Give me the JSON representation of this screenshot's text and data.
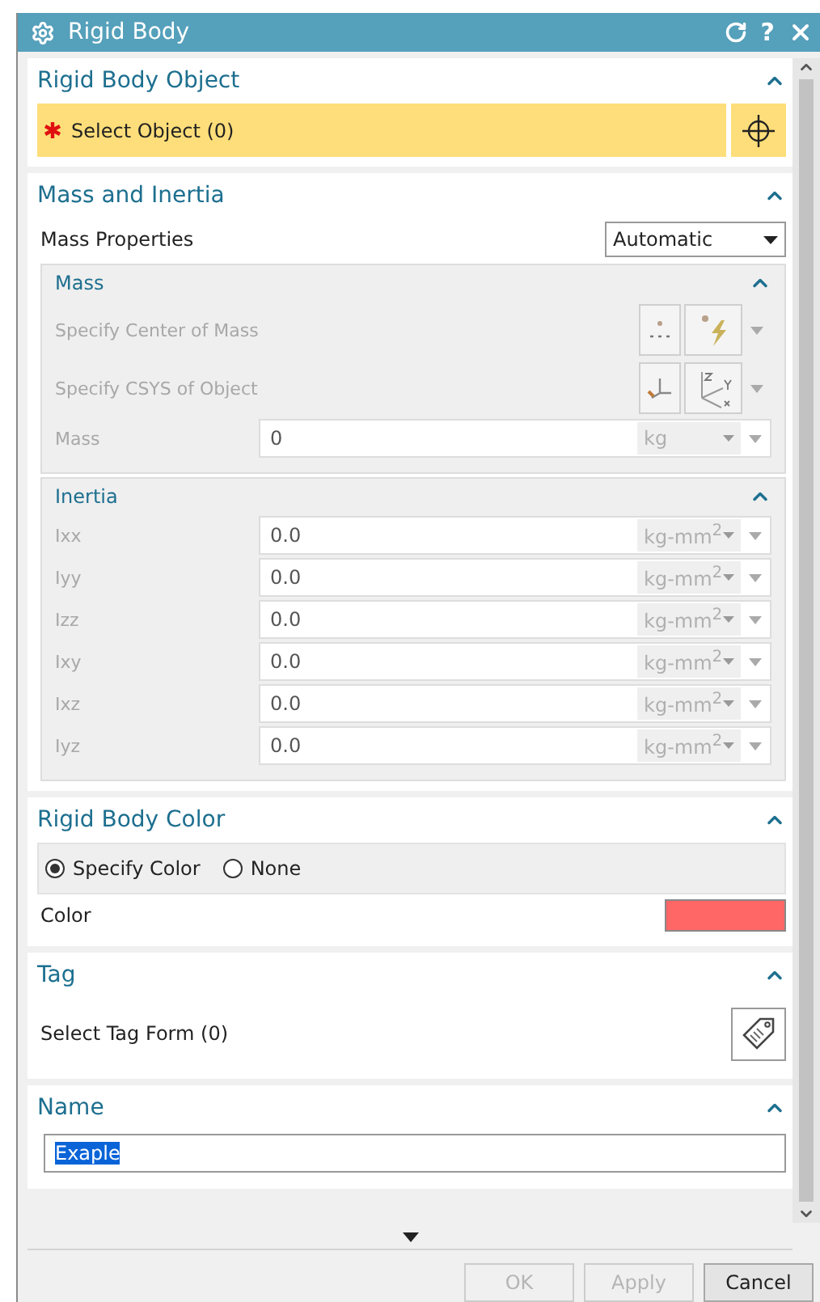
{
  "window": {
    "title": "Rigid Body",
    "help": "?"
  },
  "rigid_body_object": {
    "title": "Rigid Body Object",
    "expanded": true,
    "selection": {
      "label": "Select Object (0)",
      "required": true
    }
  },
  "mass_and_inertia": {
    "title": "Mass and Inertia",
    "expanded": true,
    "mass_properties": {
      "label": "Mass Properties",
      "value": "Automatic"
    },
    "mass": {
      "title": "Mass",
      "expanded": true,
      "disabled": true,
      "rows": [
        {
          "kind": "point",
          "label": "Specify Center of Mass"
        },
        {
          "kind": "csys",
          "label": "Specify CSYS of Object"
        },
        {
          "kind": "value",
          "label": "Mass",
          "value": "0",
          "unit": "kg"
        }
      ]
    },
    "inertia": {
      "title": "Inertia",
      "expanded": true,
      "disabled": true,
      "rows": [
        {
          "label": "Ixx",
          "value": "0.0",
          "unit": "kg-mm$^{2}$"
        },
        {
          "label": "Iyy",
          "value": "0.0",
          "unit": "kg-mm$^{2}$"
        },
        {
          "label": "Izz",
          "value": "0.0",
          "unit": "kg-mm$^{2}$"
        },
        {
          "label": "Ixy",
          "value": "0.0",
          "unit": "kg-mm$^{2}$"
        },
        {
          "label": "Ixz",
          "value": "0.0",
          "unit": "kg-mm$^{2}$"
        },
        {
          "label": "Iyz",
          "value": "0.0",
          "unit": "kg-mm$^{2}$"
        }
      ]
    }
  },
  "rigid_body_color": {
    "title": "Rigid Body Color",
    "expanded": true,
    "options": [
      {
        "label": "Specify Color",
        "selected": true
      },
      {
        "label": "None",
        "selected": false
      }
    ],
    "color_label": "Color",
    "color": "#ff6666"
  },
  "tag": {
    "title": "Tag",
    "expanded": true,
    "selection": "Select Tag Form (0)"
  },
  "name": {
    "title": "Name",
    "expanded": true,
    "value": "Exaple",
    "text_selected": true
  },
  "footer": {
    "buttons": [
      {
        "label": "OK",
        "disabled": true
      },
      {
        "label": "Apply",
        "disabled": true
      },
      {
        "label": "Cancel",
        "disabled": false
      }
    ]
  }
}
